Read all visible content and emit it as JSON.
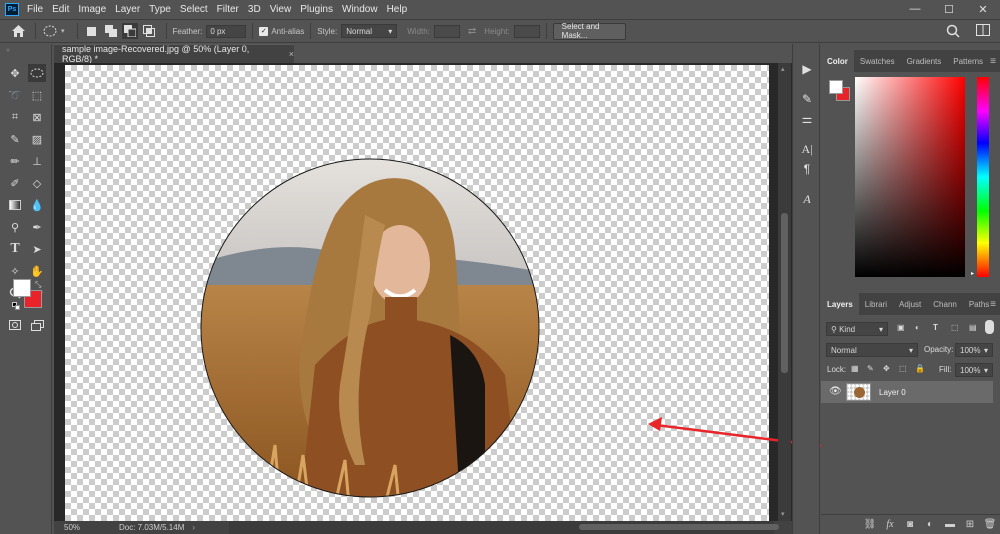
{
  "menu": {
    "logo": "Ps",
    "items": [
      "File",
      "Edit",
      "Image",
      "Layer",
      "Type",
      "Select",
      "Filter",
      "3D",
      "View",
      "Plugins",
      "Window",
      "Help"
    ]
  },
  "window_controls": {
    "minimize": "—",
    "maximize": "☐",
    "close": "✕"
  },
  "options": {
    "feather_label": "Feather:",
    "feather_value": "0 px",
    "antialias_label": "Anti-alias",
    "style_label": "Style:",
    "style_value": "Normal",
    "width_label": "Width:",
    "height_label": "Height:",
    "select_mask_label": "Select and Mask..."
  },
  "document": {
    "tab_title": "sample image-Recovered.jpg @ 50% (Layer 0, RGB/8) *",
    "close_glyph": "×",
    "zoom": "50%",
    "doc_info": "Doc: 7.03M/5.14M"
  },
  "color_panel": {
    "tabs": [
      "Color",
      "Swatches",
      "Gradients",
      "Patterns"
    ],
    "active_tab": "Color",
    "foreground": "#ffffff",
    "background": "#e8242a"
  },
  "layers_panel": {
    "tabs": [
      "Layers",
      "Librari",
      "Adjust",
      "Chann",
      "Paths"
    ],
    "active_tab": "Layers",
    "kind_label": "Kind",
    "blend_mode": "Normal",
    "opacity_label": "Opacity:",
    "opacity_value": "100%",
    "lock_label": "Lock:",
    "fill_label": "Fill:",
    "fill_value": "100%",
    "layer_name": "Layer 0",
    "footer_icons": [
      "link-icon",
      "fx-icon",
      "mask-icon",
      "adjustment-icon",
      "group-folder-icon",
      "new-layer-icon",
      "trash-icon"
    ]
  },
  "colors": {
    "ui_bg": "#535353",
    "panel_dark": "#424242",
    "canvas_bg": "#282828",
    "annotation_arrow": "#e8262a"
  }
}
